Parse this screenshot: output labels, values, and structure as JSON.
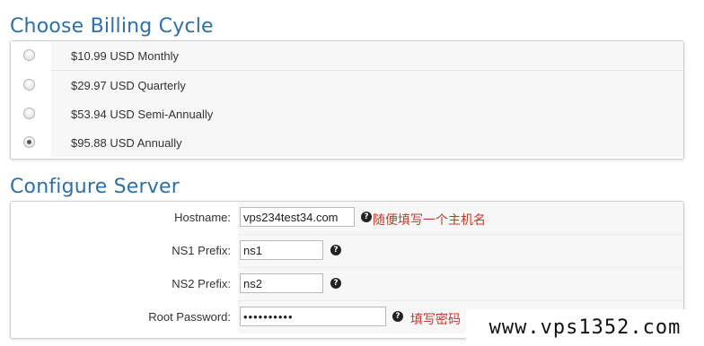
{
  "billing": {
    "title": "Choose Billing Cycle",
    "options": [
      {
        "label": "$10.99 USD Monthly",
        "selected": false
      },
      {
        "label": "$29.97 USD Quarterly",
        "selected": false
      },
      {
        "label": "$53.94 USD Semi-Annually",
        "selected": false
      },
      {
        "label": "$95.88 USD Annually",
        "selected": true
      }
    ]
  },
  "server": {
    "title": "Configure Server",
    "hostname": {
      "label": "Hostname:",
      "value": "vps234test34.com",
      "note": "随便填写一个主机名"
    },
    "ns1": {
      "label": "NS1 Prefix:",
      "value": "ns1"
    },
    "ns2": {
      "label": "NS2 Prefix:",
      "value": "ns2"
    },
    "root_password": {
      "label": "Root Password:",
      "value": "••••••••••",
      "note": "填写密码"
    }
  },
  "help_icon": {
    "glyph": "?"
  },
  "watermark": {
    "text": "www.vps1352.com"
  },
  "colors": {
    "title": "#2f6fa5",
    "note": "#c0392b"
  }
}
